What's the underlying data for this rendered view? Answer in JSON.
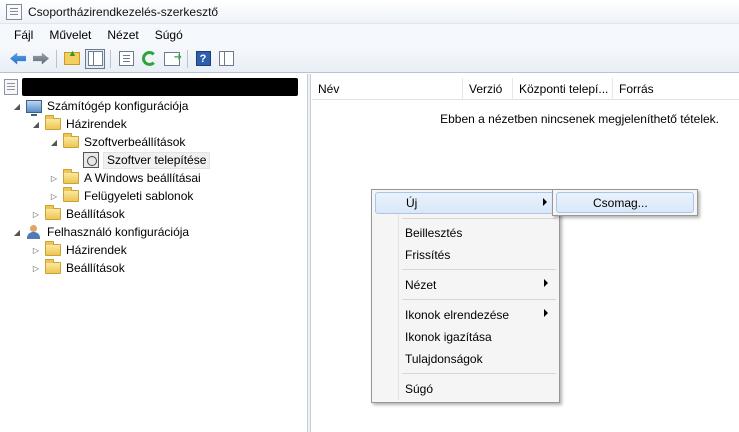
{
  "window": {
    "title": "Csoportházirendkezelés-szerkesztő"
  },
  "menubar": {
    "items": [
      "Fájl",
      "Művelet",
      "Nézet",
      "Súgó"
    ]
  },
  "toolbar": {
    "icons": [
      "back-arrow-icon",
      "forward-arrow-icon",
      "up-folder-icon",
      "show-hide-tree-icon",
      "properties-icon",
      "refresh-icon",
      "export-list-icon",
      "help-icon",
      "show-hide-action-pane-icon"
    ]
  },
  "tree": {
    "computer_config": "Számítógép konfigurációja",
    "policies": "Házirendek",
    "software_settings": "Szoftverbeállítások",
    "software_install": "Szoftver telepítése",
    "windows_settings": "A Windows beállításai",
    "admin_templates": "Felügyeleti sablonok",
    "preferences": "Beállítások",
    "user_config": "Felhasználó konfigurációja",
    "user_policies": "Házirendek",
    "user_preferences": "Beállítások"
  },
  "list": {
    "columns": [
      "Név",
      "Verzió",
      "Központi telepí...",
      "Forrás"
    ],
    "empty_message": "Ebben a nézetben nincsenek megjeleníthető tételek."
  },
  "context_menu": {
    "new": "Új",
    "paste": "Beillesztés",
    "refresh": "Frissítés",
    "view": "Nézet",
    "arrange_icons": "Ikonok elrendezése",
    "align_icons": "Ikonok igazítása",
    "properties": "Tulajdonságok",
    "help": "Súgó"
  },
  "submenu": {
    "package": "Csomag..."
  }
}
